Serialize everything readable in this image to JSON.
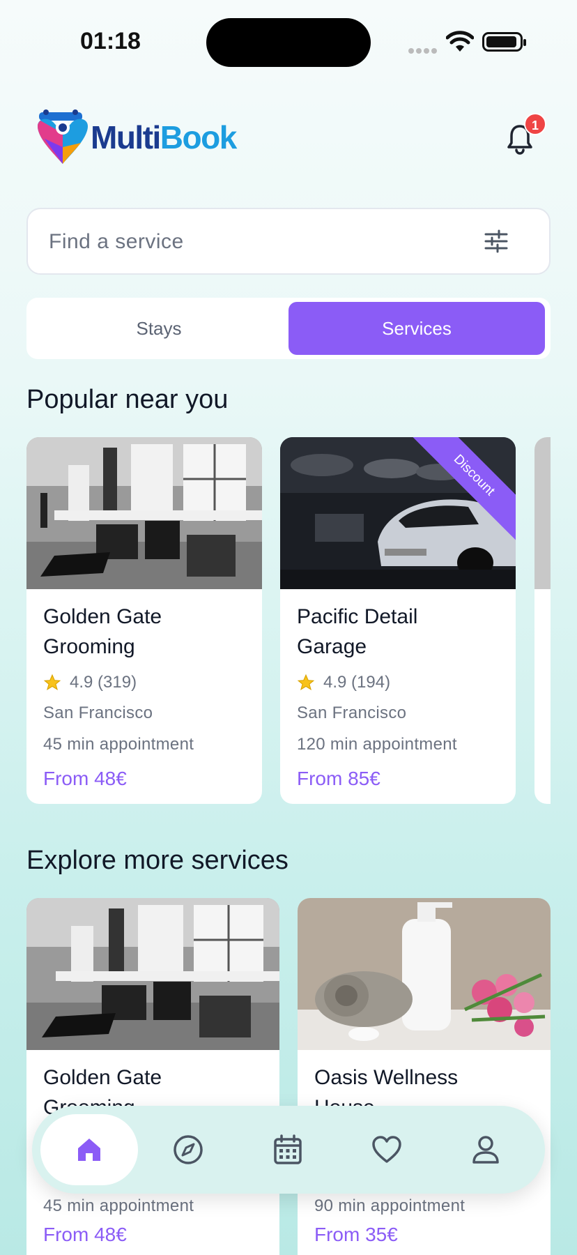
{
  "status": {
    "time": "01:18",
    "battery_level": 0.95
  },
  "header": {
    "logo_part1": "Multi",
    "logo_part2": "Book",
    "notification_count": "1"
  },
  "search": {
    "placeholder": "Find a service"
  },
  "tabs": [
    {
      "label": "Stays",
      "active": false
    },
    {
      "label": "Services",
      "active": true
    }
  ],
  "sections": {
    "popular": "Popular near you",
    "explore": "Explore more services"
  },
  "popular_cards": [
    {
      "title_line1": "Golden Gate",
      "title_line2": "Grooming",
      "rating": "4.9 (319)",
      "city": "San Francisco",
      "duration": "45 min appointment",
      "price": "From 48€",
      "image": "salon-interior"
    },
    {
      "title_line1": "Pacific Detail",
      "title_line2": "Garage",
      "rating": "4.9 (194)",
      "city": "San Francisco",
      "duration": "120 min appointment",
      "price": "From 85€",
      "badge": "Discount",
      "image": "car-garage"
    }
  ],
  "explore_cards": [
    {
      "title_line1": "Golden Gate",
      "title_line2": "Grooming",
      "duration": "45 min appointment",
      "price": "From 48€",
      "image": "salon-interior"
    },
    {
      "title_line1": "Oasis Wellness",
      "title_line2": "House",
      "duration": "90 min appointment",
      "price": "From 35€",
      "image": "spa-towels"
    }
  ],
  "nav": [
    {
      "icon": "home-icon",
      "active": true
    },
    {
      "icon": "compass-icon",
      "active": false
    },
    {
      "icon": "calendar-icon",
      "active": false
    },
    {
      "icon": "heart-icon",
      "active": false
    },
    {
      "icon": "user-icon",
      "active": false
    }
  ],
  "colors": {
    "accent": "#8b5cf6",
    "badge": "#ef4444",
    "logo_dark": "#1b3b8f",
    "logo_light": "#1d9de0"
  }
}
